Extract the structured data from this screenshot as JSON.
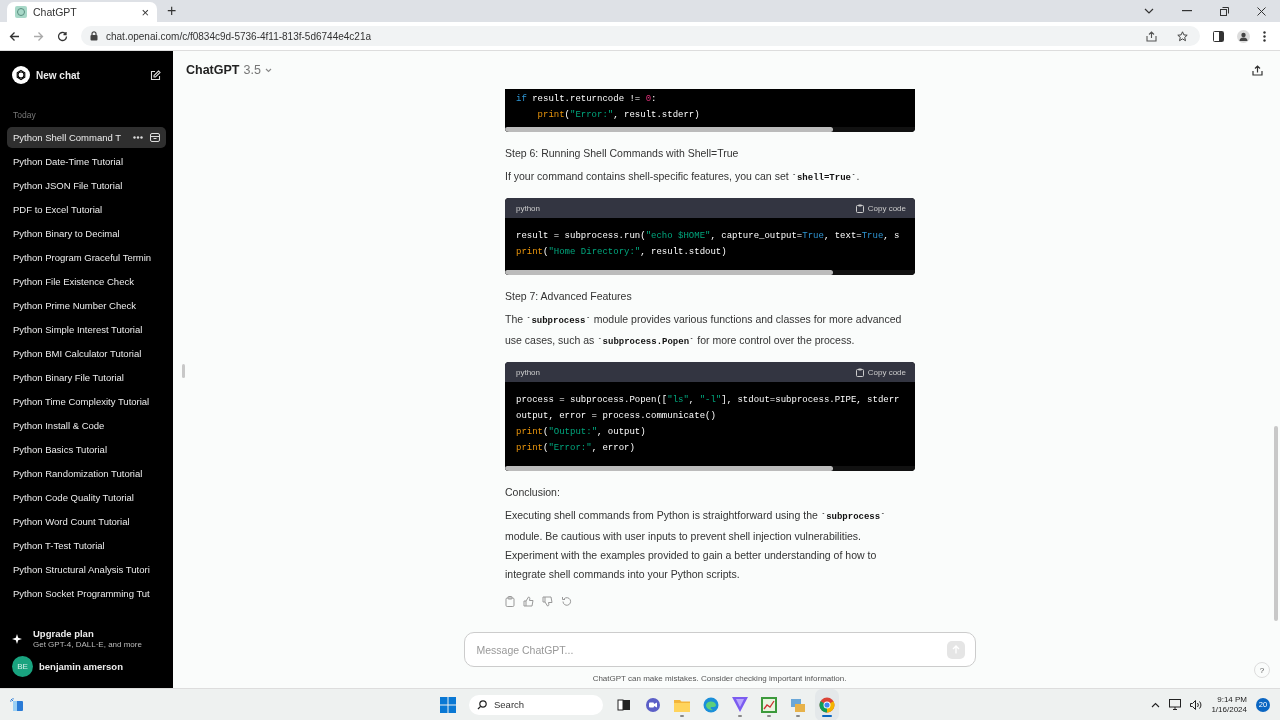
{
  "browser": {
    "tab": {
      "title": "ChatGPT",
      "close": "×"
    },
    "new_tab": "+",
    "address": "chat.openai.com/c/f0834c9d-5736-4f11-813f-5d6744e4c21a"
  },
  "sidebar": {
    "new_chat": "New chat",
    "section": "Today",
    "items": [
      {
        "title": "Python Shell Command T",
        "selected": true
      },
      {
        "title": "Python Date-Time Tutorial",
        "selected": false
      },
      {
        "title": "Python JSON File Tutorial",
        "selected": false
      },
      {
        "title": "PDF to Excel Tutorial",
        "selected": false
      },
      {
        "title": "Python Binary to Decimal",
        "selected": false
      },
      {
        "title": "Python Program Graceful Termin",
        "selected": false
      },
      {
        "title": "Python File Existence Check",
        "selected": false
      },
      {
        "title": "Python Prime Number Check",
        "selected": false
      },
      {
        "title": "Python Simple Interest Tutorial",
        "selected": false
      },
      {
        "title": "Python BMI Calculator Tutorial",
        "selected": false
      },
      {
        "title": "Python Binary File Tutorial",
        "selected": false
      },
      {
        "title": "Python Time Complexity Tutorial",
        "selected": false
      },
      {
        "title": "Python Install & Code",
        "selected": false
      },
      {
        "title": "Python Basics Tutorial",
        "selected": false
      },
      {
        "title": "Python Randomization Tutorial",
        "selected": false
      },
      {
        "title": "Python Code Quality Tutorial",
        "selected": false
      },
      {
        "title": "Python Word Count Tutorial",
        "selected": false
      },
      {
        "title": "Python T-Test Tutorial",
        "selected": false
      },
      {
        "title": "Python Structural Analysis Tutori",
        "selected": false
      },
      {
        "title": "Python Socket Programming Tut",
        "selected": false
      }
    ],
    "upgrade": {
      "title": "Upgrade plan",
      "subtitle": "Get GPT-4, DALL·E, and more"
    },
    "user": {
      "initials": "BE",
      "name": "benjamin amerson"
    }
  },
  "header": {
    "model": "ChatGPT",
    "version": "3.5"
  },
  "content": [
    {
      "kind": "code",
      "lines": [
        {
          "kind": "flat",
          "tokens": [
            {
              "kind": "keyword",
              "text": "if"
            },
            {
              "kind": "plain",
              "text": " result.returncode != "
            },
            {
              "kind": "number",
              "text": "0"
            },
            {
              "kind": "plain",
              "text": ":"
            }
          ]
        },
        {
          "kind": "indented",
          "tokens": [
            {
              "kind": "builtin",
              "text": "print"
            },
            {
              "kind": "plain",
              "text": "("
            },
            {
              "kind": "string",
              "text": "\"Error:\""
            },
            {
              "kind": "plain",
              "text": ", result.stderr)"
            }
          ]
        }
      ]
    },
    {
      "kind": "heading",
      "text": "Step 6: Running Shell Commands with Shell=True"
    },
    {
      "kind": "paragraph",
      "parts": [
        {
          "kind": "text",
          "text": "If your command contains shell-specific features, you can set "
        },
        {
          "kind": "code",
          "text": "`shell=True`"
        },
        {
          "kind": "text",
          "text": "."
        }
      ]
    },
    {
      "kind": "code",
      "language": "python",
      "copy": "Copy code",
      "lines": [
        {
          "kind": "flat",
          "tokens": [
            {
              "kind": "plain",
              "text": "result = subprocess.run("
            },
            {
              "kind": "string",
              "text": "\"echo $HOME\""
            },
            {
              "kind": "plain",
              "text": ", capture_output="
            },
            {
              "kind": "keyword",
              "text": "True"
            },
            {
              "kind": "plain",
              "text": ", text="
            },
            {
              "kind": "keyword",
              "text": "True"
            },
            {
              "kind": "plain",
              "text": ", s"
            }
          ]
        },
        {
          "kind": "flat",
          "tokens": [
            {
              "kind": "builtin",
              "text": "print"
            },
            {
              "kind": "plain",
              "text": "("
            },
            {
              "kind": "string",
              "text": "\"Home Directory:\""
            },
            {
              "kind": "plain",
              "text": ", result.stdout)"
            }
          ]
        }
      ]
    },
    {
      "kind": "heading",
      "text": "Step 7: Advanced Features"
    },
    {
      "kind": "paragraph",
      "parts": [
        {
          "kind": "text",
          "text": "The "
        },
        {
          "kind": "code",
          "text": "`subprocess`"
        },
        {
          "kind": "text",
          "text": " module provides various functions and classes for more advanced use cases, such as "
        },
        {
          "kind": "code",
          "text": "`subprocess.Popen`"
        },
        {
          "kind": "text",
          "text": " for more control over the process."
        }
      ]
    },
    {
      "kind": "code",
      "language": "python",
      "copy": "Copy code",
      "lines": [
        {
          "kind": "flat",
          "tokens": [
            {
              "kind": "plain",
              "text": "process = subprocess.Popen(["
            },
            {
              "kind": "string",
              "text": "\"ls\""
            },
            {
              "kind": "plain",
              "text": ", "
            },
            {
              "kind": "string",
              "text": "\"-l\""
            },
            {
              "kind": "plain",
              "text": "], stdout=subprocess.PIPE, stderr"
            }
          ]
        },
        {
          "kind": "flat",
          "tokens": [
            {
              "kind": "plain",
              "text": "output, error = process.communicate()"
            }
          ]
        },
        {
          "kind": "flat",
          "tokens": [
            {
              "kind": "builtin",
              "text": "print"
            },
            {
              "kind": "plain",
              "text": "("
            },
            {
              "kind": "string",
              "text": "\"Output:\""
            },
            {
              "kind": "plain",
              "text": ", output)"
            }
          ]
        },
        {
          "kind": "flat",
          "tokens": [
            {
              "kind": "builtin",
              "text": "print"
            },
            {
              "kind": "plain",
              "text": "("
            },
            {
              "kind": "string",
              "text": "\"Error:\""
            },
            {
              "kind": "plain",
              "text": ", error)"
            }
          ]
        }
      ]
    },
    {
      "kind": "heading",
      "text": "Conclusion:"
    },
    {
      "kind": "paragraph",
      "parts": [
        {
          "kind": "text",
          "text": "Executing shell commands from Python is straightforward using the "
        },
        {
          "kind": "code",
          "text": "`subprocess`"
        },
        {
          "kind": "text",
          "text": " module. Be cautious with user inputs to prevent shell injection vulnerabilities. Experiment with the examples provided to gain a better understanding of how to integrate shell commands into your Python scripts."
        }
      ]
    }
  ],
  "composer": {
    "placeholder": "Message ChatGPT...",
    "send_disabled": true
  },
  "disclaimer": "ChatGPT can make mistakes. Consider checking important information.",
  "help": "?",
  "taskbar": {
    "search": "Search",
    "time": "9:14 PM",
    "date": "1/16/2024",
    "notifications": "20",
    "apps": [
      {
        "kind": "taskview",
        "open": false,
        "active": false
      },
      {
        "kind": "chat",
        "open": false,
        "active": false
      },
      {
        "kind": "files",
        "open": true,
        "active": false
      },
      {
        "kind": "edge",
        "open": false,
        "active": false
      },
      {
        "kind": "vpn",
        "open": true,
        "active": false
      },
      {
        "kind": "chart",
        "open": true,
        "active": false
      },
      {
        "kind": "network",
        "open": true,
        "active": false
      },
      {
        "kind": "chrome",
        "open": true,
        "active": true
      }
    ]
  }
}
